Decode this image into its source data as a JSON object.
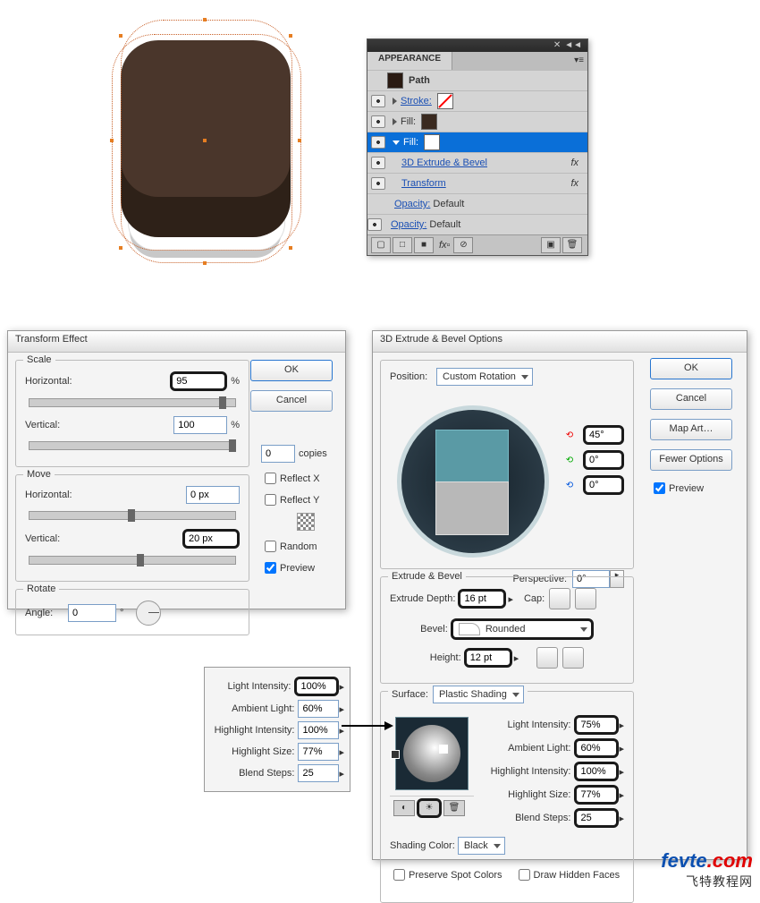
{
  "appearance": {
    "title": "APPEARANCE",
    "path": "Path",
    "stroke_label": "Stroke:",
    "fill_label": "Fill:",
    "fx_extrude": "3D Extrude & Bevel",
    "fx_transform": "Transform",
    "opacity_label": "Opacity:",
    "opacity_value": "Default",
    "fx_suffix": "fx",
    "stroke_color": "#ffffff",
    "fill1_color": "#3a2a20",
    "fill2_color": "#ffffff"
  },
  "transform": {
    "dialog_title": "Transform Effect",
    "scale_legend": "Scale",
    "move_legend": "Move",
    "rotate_legend": "Rotate",
    "horizontal_label": "Horizontal:",
    "vertical_label": "Vertical:",
    "angle_label": "Angle:",
    "scale_h": "95",
    "scale_h_unit": "%",
    "scale_v": "100",
    "scale_v_unit": "%",
    "move_h": "0 px",
    "move_v": "20 px",
    "angle": "0",
    "angle_unit": "°",
    "copies_label": "copies",
    "copies": "0",
    "reflectx": "Reflect X",
    "reflecty": "Reflect Y",
    "random": "Random",
    "preview": "Preview",
    "ok": "OK",
    "cancel": "Cancel"
  },
  "d3": {
    "dialog_title": "3D Extrude & Bevel Options",
    "position_label": "Position:",
    "position_value": "Custom Rotation",
    "rot_x": "45°",
    "rot_y": "0°",
    "rot_z": "0°",
    "perspective_label": "Perspective:",
    "perspective": "0°",
    "extrude_legend": "Extrude & Bevel",
    "depth_label": "Extrude Depth:",
    "depth": "16 pt",
    "cap_label": "Cap:",
    "bevel_label": "Bevel:",
    "bevel_value": "Rounded",
    "height_label": "Height:",
    "height": "12 pt",
    "surface_legend": "Surface:",
    "surface_value": "Plastic Shading",
    "light_intensity_label": "Light Intensity:",
    "light_intensity": "75%",
    "ambient_label": "Ambient Light:",
    "ambient": "60%",
    "hi_int_label": "Highlight Intensity:",
    "hi_int": "100%",
    "hi_size_label": "Highlight Size:",
    "hi_size": "77%",
    "blend_label": "Blend Steps:",
    "blend": "25",
    "shading_label": "Shading Color:",
    "shading_value": "Black",
    "preserve": "Preserve Spot Colors",
    "hidden": "Draw Hidden Faces",
    "ok": "OK",
    "cancel": "Cancel",
    "map": "Map Art…",
    "fewer": "Fewer Options",
    "preview": "Preview"
  },
  "back_light": {
    "light_intensity_label": "Light Intensity:",
    "light_intensity": "100%",
    "ambient_label": "Ambient Light:",
    "ambient": "60%",
    "hi_int_label": "Highlight Intensity:",
    "hi_int": "100%",
    "hi_size_label": "Highlight Size:",
    "hi_size": "77%",
    "blend_label": "Blend Steps:",
    "blend": "25"
  },
  "watermark": {
    "line1a": "fevte",
    "line1b": ".com",
    "line2": "飞特教程网"
  }
}
